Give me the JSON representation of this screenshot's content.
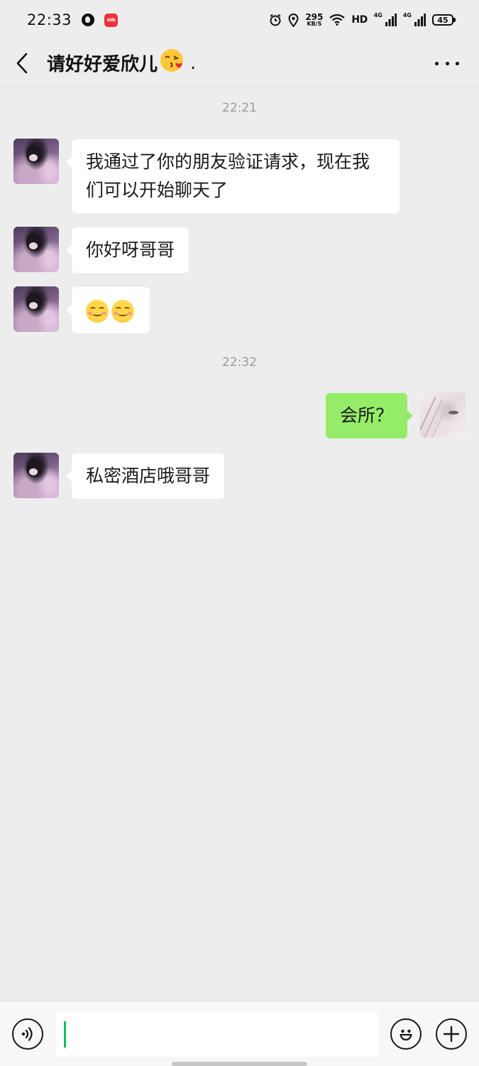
{
  "status_bar": {
    "time": "22:33",
    "app_badge": "ddb",
    "net_speed_value": "295",
    "net_speed_unit": "KB/S",
    "hd_label": "HD",
    "net_type_1": "4G",
    "net_type_2": "4G",
    "battery": "45",
    "icons": [
      "alarm-icon",
      "location-icon",
      "wifi-icon",
      "signal-icon",
      "battery-icon"
    ]
  },
  "header": {
    "title": "请好好爱欣儿",
    "title_emoji": "😘",
    "title_suffix": ".",
    "back_icon": "chevron-left-icon",
    "more_icon": "more-dots-icon"
  },
  "messages": {
    "ts1": "22:21",
    "m1": "我通过了你的朋友验证请求，现在我们可以开始聊天了",
    "m2": "你好呀哥哥",
    "m3_emoji": "smile-emoji x2",
    "ts2": "22:32",
    "m4": "会所？",
    "m5": "私密酒店哦哥哥"
  },
  "input_bar": {
    "value": "",
    "voice_icon": "voice-icon",
    "emoji_icon": "emoji-icon",
    "plus_icon": "plus-icon"
  },
  "colors": {
    "background": "#ededed",
    "self_bubble": "#95ec69",
    "other_bubble": "#ffffff",
    "caret": "#07c160"
  }
}
